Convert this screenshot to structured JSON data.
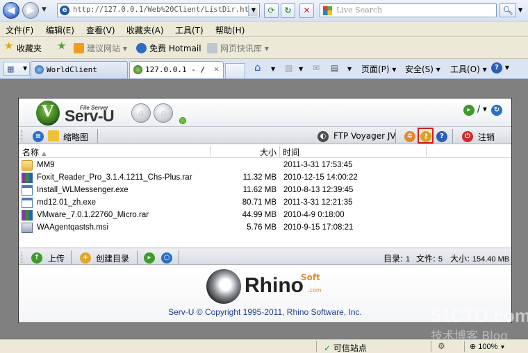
{
  "browser": {
    "url": "http://127.0.0.1/Web%20Client/ListDir.htm",
    "search_placeholder": "Live Search",
    "menu": [
      "文件(F)",
      "编辑(E)",
      "查看(V)",
      "收藏夹(A)",
      "工具(T)",
      "帮助(H)"
    ],
    "favorites": {
      "label": "收藏夹",
      "items": [
        "建议网站 ▾",
        "免费 Hotmail",
        "网页快讯库 ▾"
      ]
    },
    "tabs": [
      {
        "label": "WorldClient",
        "active": false
      },
      {
        "label": "127.0.0.1 - /",
        "active": true
      }
    ],
    "commands": [
      "页面(P) ▾",
      "安全(S) ▾",
      "工具(O) ▾"
    ],
    "status": {
      "trusted": "可信站点",
      "zoom": "100%"
    }
  },
  "servu": {
    "logo_sub": "File Server",
    "logo_text": "Serv-U",
    "header_right": "/ ▾",
    "toolbar": {
      "thumbnail_label": "缩略图",
      "ftp_voyager_label": "FTP Voyager JV",
      "logout_label": "注销"
    },
    "columns": {
      "name": "名称",
      "size": "大小",
      "time": "时间"
    },
    "files": [
      {
        "type": "folder",
        "name": "MM9",
        "size": "",
        "time": "2011-3-31 17:53:45"
      },
      {
        "type": "rar",
        "name": "Foxit_Reader_Pro_3.1.4.1211_Chs-Plus.rar",
        "size": "11.32 MB",
        "time": "2010-12-15 14:00:22"
      },
      {
        "type": "exe",
        "name": "Install_WLMessenger.exe",
        "size": "11.62 MB",
        "time": "2010-8-13 12:39:45"
      },
      {
        "type": "exe",
        "name": "md12.01_zh.exe",
        "size": "80.71 MB",
        "time": "2011-3-31 12:21:35"
      },
      {
        "type": "rar",
        "name": "VMware_7.0.1.22760_Micro.rar",
        "size": "44.99 MB",
        "time": "2010-4-9 0:18:00"
      },
      {
        "type": "msi",
        "name": "WAAgentqastsh.msi",
        "size": "5.76 MB",
        "time": "2010-9-15 17:08:21"
      }
    ],
    "bottombar": {
      "upload_label": "上传",
      "mkdir_label": "创建目录",
      "dirs_label": "目录:",
      "dirs_value": "1",
      "files_label": "文件:",
      "files_value": "5",
      "size_label": "大小:",
      "size_value": "154.40 MB"
    },
    "footer": {
      "logo_text": "Rhino",
      "logo_soft": "Soft",
      "logo_com": ".com",
      "copyright": "Serv-U © Copyright 1995-2011, Rhino Software, Inc."
    }
  },
  "watermark": {
    "main": "51CTO.com",
    "sub": "技术博客 Blog"
  }
}
